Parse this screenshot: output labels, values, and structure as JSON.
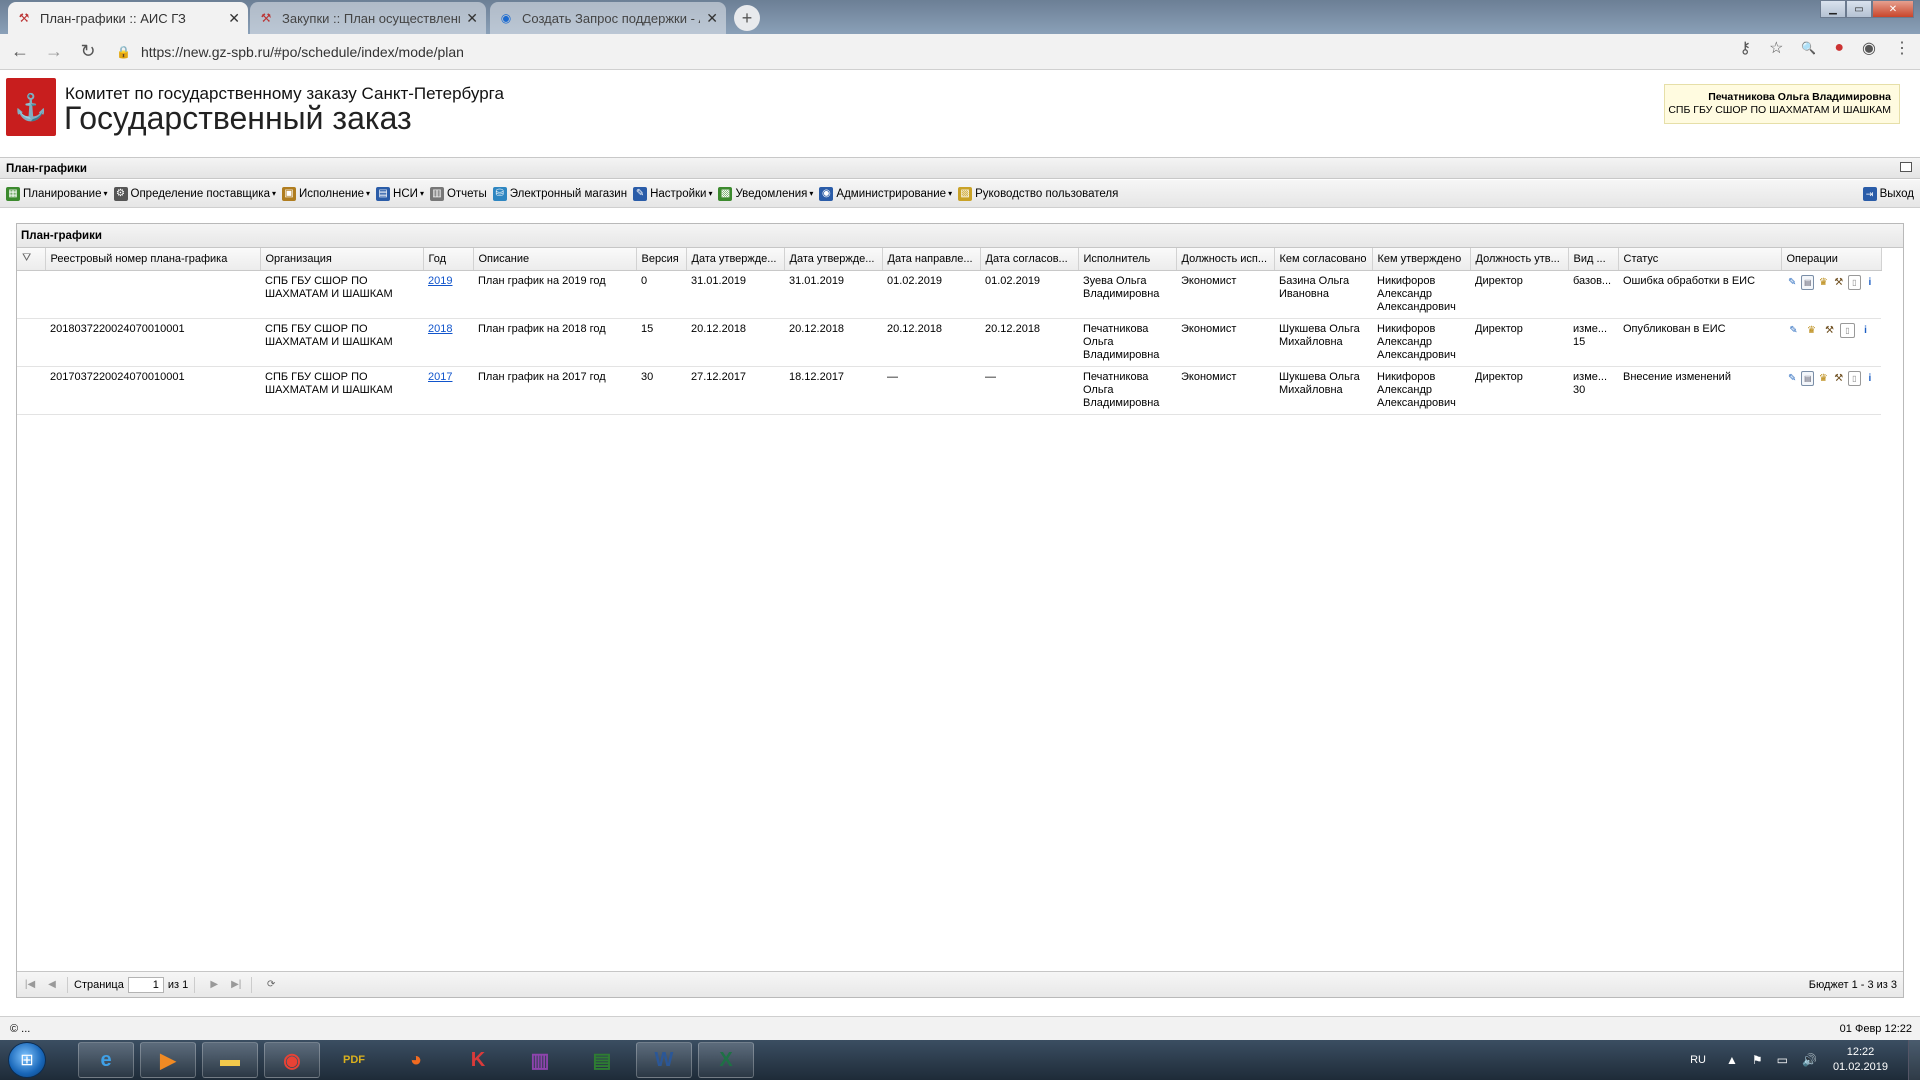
{
  "browser": {
    "tabs": [
      {
        "title": "План-графики :: АИС ГЗ",
        "active": true,
        "icon": "gz-tools-icon"
      },
      {
        "title": "Закупки :: План осуществления",
        "active": false,
        "icon": "gz-tools-icon"
      },
      {
        "title": "Создать Запрос поддержки - АИ",
        "active": false,
        "icon": "support-icon"
      }
    ],
    "url": "https://new.gz-spb.ru/#po/schedule/index/mode/plan"
  },
  "header": {
    "org_line1": "Комитет по государственному заказу Санкт-Петербурга",
    "org_line2": "Государственный заказ",
    "user_name": "Печатникова Ольга Владимировна",
    "user_org": "СПБ ГБУ СШОР ПО ШАХМАТАМ И ШАШКАМ"
  },
  "section_title": "План-графики",
  "menu": {
    "items": [
      {
        "label": "Планирование",
        "dropdown": true,
        "icon": "planning-icon",
        "color": "#3c8a2e"
      },
      {
        "label": "Определение поставщика",
        "dropdown": true,
        "icon": "supplier-icon",
        "color": "#555555"
      },
      {
        "label": "Исполнение",
        "dropdown": true,
        "icon": "execution-icon",
        "color": "#b07d1f"
      },
      {
        "label": "НСИ",
        "dropdown": true,
        "icon": "reference-icon",
        "color": "#2a5ca8"
      },
      {
        "label": "Отчеты",
        "dropdown": false,
        "icon": "reports-icon",
        "color": "#777777"
      },
      {
        "label": "Электронный магазин",
        "dropdown": false,
        "icon": "shop-icon",
        "color": "#2e86c1"
      },
      {
        "label": "Настройки",
        "dropdown": true,
        "icon": "settings-icon",
        "color": "#2a5ca8"
      },
      {
        "label": "Уведомления",
        "dropdown": true,
        "icon": "notifications-icon",
        "color": "#3c8a2e"
      },
      {
        "label": "Администрирование",
        "dropdown": true,
        "icon": "admin-icon",
        "color": "#2a5ca8"
      },
      {
        "label": "Руководство пользователя",
        "dropdown": false,
        "icon": "manual-icon",
        "color": "#c9a227"
      }
    ],
    "exit_label": "Выход"
  },
  "grid": {
    "title": "План-графики",
    "columns": [
      "",
      "Реестровый номер плана-графика",
      "Организация",
      "Год",
      "Описание",
      "Версия",
      "Дата утвержде...",
      "Дата утвержде...",
      "Дата направле...",
      "Дата согласов...",
      "Исполнитель",
      "Должность исп...",
      "Кем согласовано",
      "Кем утверждено",
      "Должность утв...",
      "Вид ...",
      "Статус",
      "Операции"
    ],
    "rows": [
      {
        "reg": "",
        "org": "СПБ ГБУ СШОР ПО ШАХМАТАМ И ШАШКАМ",
        "year": "2019",
        "desc": "План график на 2019 год",
        "version": "0",
        "d1": "31.01.2019",
        "d2": "31.01.2019",
        "d3": "01.02.2019",
        "d4": "01.02.2019",
        "executor": "Зуева Ольга Владимировна",
        "exec_pos": "Экономист",
        "agreed": "Базина Ольга Ивановна",
        "approved": "Никифоров Александр Александрович",
        "appr_pos": "Директор",
        "kind": "базов...",
        "status": "Ошибка обработки в ЕИС",
        "ops": [
          "edit",
          "doc",
          "emb",
          "flow",
          "paper",
          "info"
        ]
      },
      {
        "reg": "201803722002407001000​1",
        "org": "СПБ ГБУ СШОР ПО ШАХМАТАМ И ШАШКАМ",
        "year": "2018",
        "desc": "План график на 2018 год",
        "version": "15",
        "d1": "20.12.2018",
        "d2": "20.12.2018",
        "d3": "20.12.2018",
        "d4": "20.12.2018",
        "executor": "Печатникова Ольга Владимировна",
        "exec_pos": "Экономист",
        "agreed": "Шукшева Ольга Михайловна",
        "approved": "Никифоров Александр Александрович",
        "appr_pos": "Директор",
        "kind": "изме... 15",
        "status": "Опубликован в ЕИС",
        "ops": [
          "edit",
          "emb",
          "flow",
          "paper",
          "info"
        ]
      },
      {
        "reg": "201703722002407001000​1",
        "org": "СПБ ГБУ СШОР ПО ШАХМАТАМ И ШАШКАМ",
        "year": "2017",
        "desc": "План график на 2017 год",
        "version": "30",
        "d1": "27.12.2017",
        "d2": "18.12.2017",
        "d3": "—",
        "d4": "—",
        "executor": "Печатникова Ольга Владимировна",
        "exec_pos": "Экономист",
        "agreed": "Шукшева Ольга Михайловна",
        "approved": "Никифоров Александр Александрович",
        "appr_pos": "Директор",
        "kind": "изме... 30",
        "status": "Внесение изменений",
        "ops": [
          "edit",
          "doc",
          "emb",
          "flow",
          "paper",
          "info"
        ]
      }
    ]
  },
  "pager": {
    "page_label": "Страница",
    "page_value": "1",
    "of_label": "из 1",
    "summary": "Бюджет 1 - 3 из 3"
  },
  "status": {
    "left": "© ...",
    "right": "01 Февр 12:22"
  },
  "taskbar": {
    "apps": [
      "ie-icon",
      "media-player-icon",
      "explorer-icon",
      "chrome-icon",
      "pdf-icon",
      "firefox-icon",
      "kaspersky-icon",
      "winrar-icon",
      "pdf-editor-icon",
      "word-icon",
      "excel-icon"
    ],
    "lang": "RU",
    "time": "12:22",
    "date": "01.02.2019"
  }
}
